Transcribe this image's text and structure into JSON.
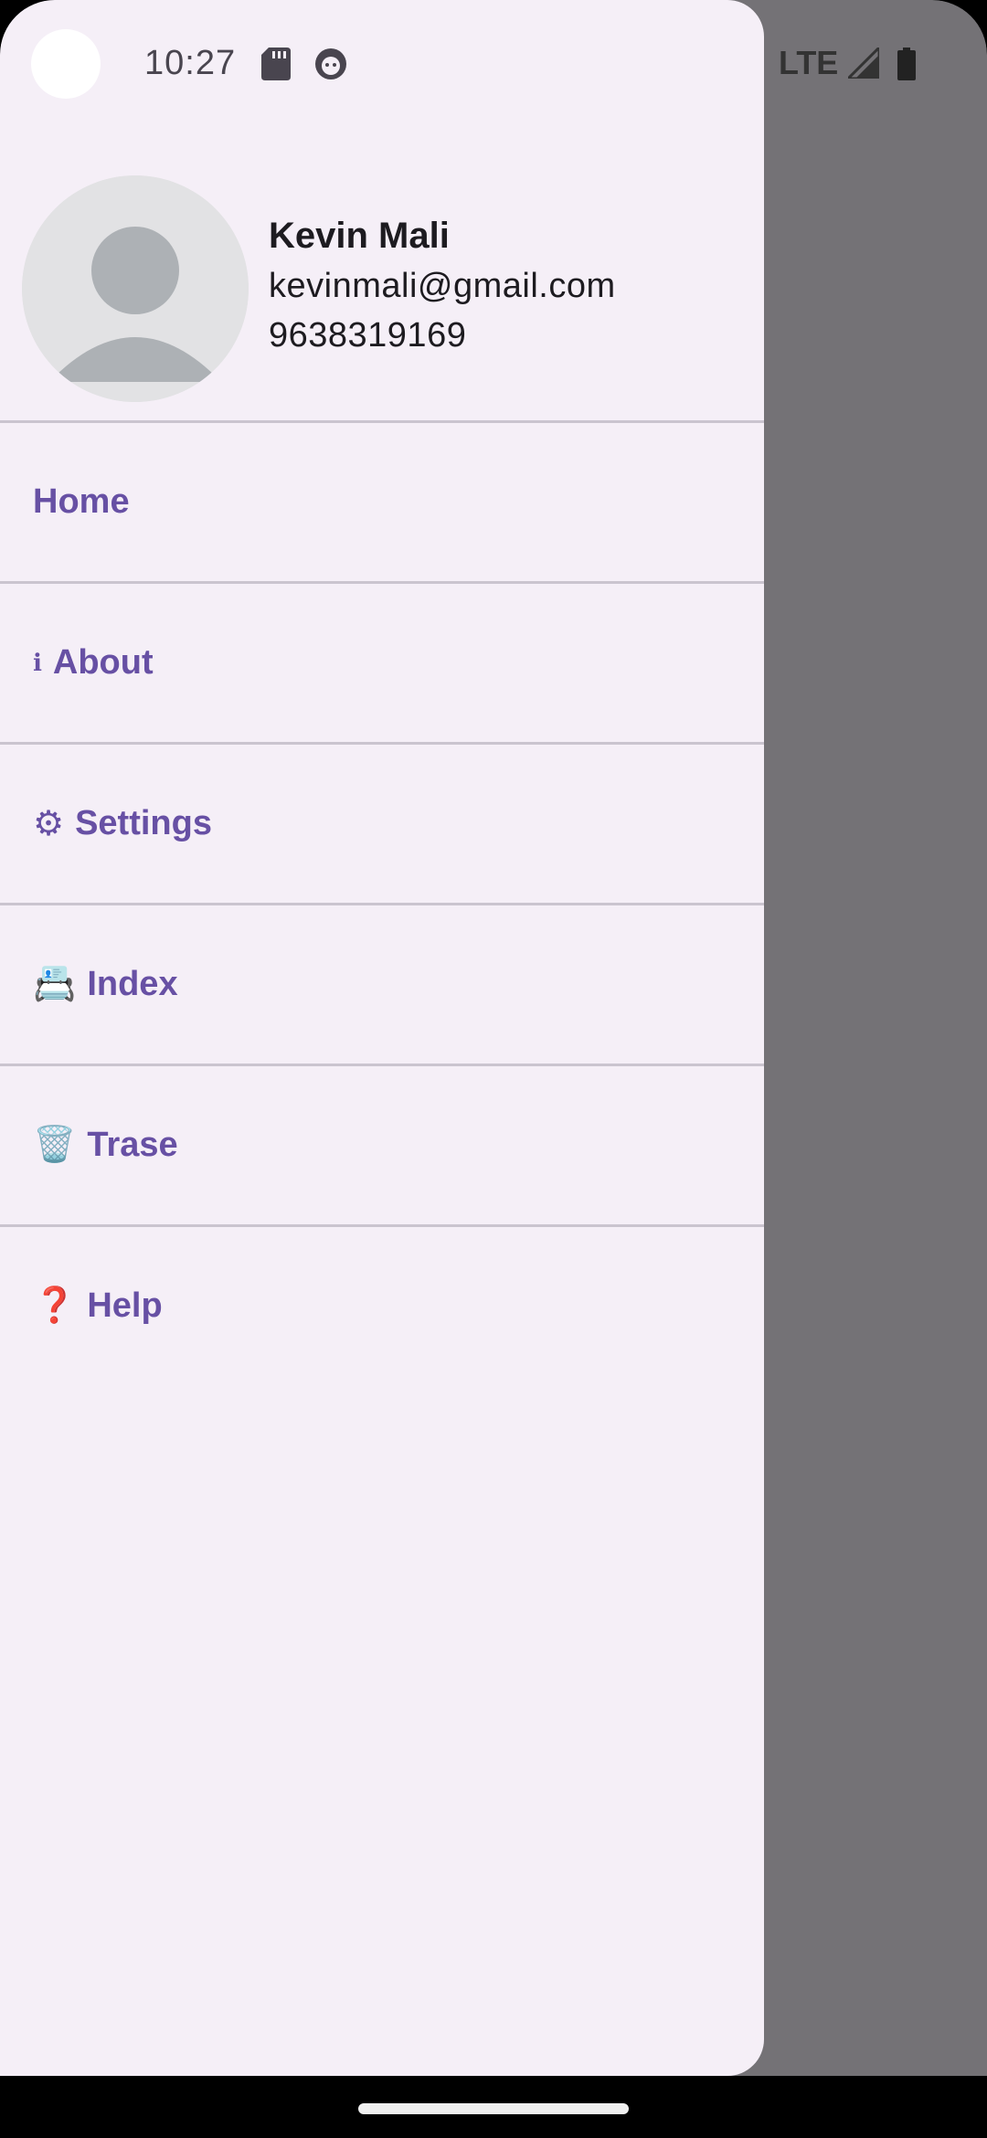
{
  "status_bar": {
    "time": "10:27",
    "network": "LTE",
    "icons": [
      "sd-card-icon",
      "face-icon",
      "signal-icon",
      "battery-icon"
    ]
  },
  "profile": {
    "name": "Kevin Mali",
    "email": "kevinmali@gmail.com",
    "phone": "9638319169",
    "avatar": "default-avatar-icon"
  },
  "menu": {
    "items": [
      {
        "label": "Home",
        "glyph": ""
      },
      {
        "label": "About",
        "glyph": "ℹ"
      },
      {
        "label": "Settings",
        "glyph": "⚙"
      },
      {
        "label": "Index",
        "glyph": "📇"
      },
      {
        "label": "Trase",
        "glyph": "🗑️"
      },
      {
        "label": "Help",
        "glyph": "❓"
      }
    ]
  },
  "colors": {
    "drawer_bg": "#f5eff7",
    "accent": "#6750a4",
    "scrim": "#747276",
    "divider": "#cac4cf"
  }
}
